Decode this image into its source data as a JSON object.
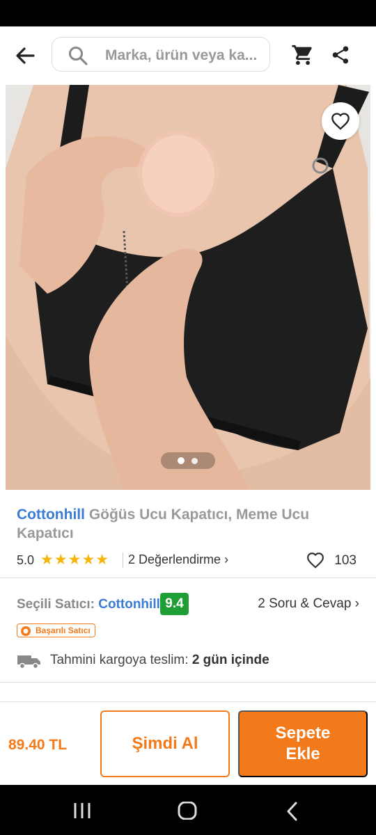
{
  "search": {
    "placeholder": "Marka, ürün veya ka..."
  },
  "product": {
    "brand": "Cottonhill",
    "name": "Göğüs Ucu Kapatıcı, Meme Ucu Kapatıcı",
    "rating": "5.0",
    "stars": "★★★★★",
    "reviews_label": "2 Değerlendirme ›",
    "likes": "103",
    "image_pages": 2,
    "image_current": 1
  },
  "seller": {
    "label": "Seçili Satıcı:",
    "name": "Cottonhill",
    "score": "9.4",
    "qa_label": "2 Soru & Cevap ›",
    "badge": "Başarılı Satıcı"
  },
  "shipping": {
    "label": "Tahmini kargoya teslim:",
    "value": "2 gün içinde"
  },
  "purchase": {
    "price": "89.40 TL",
    "buy_now": "Şimdi Al",
    "add_to_cart": "Sepete Ekle"
  },
  "colors": {
    "accent": "#f27a1a",
    "link": "#3a7bd5",
    "score_green": "#1f9e36"
  }
}
